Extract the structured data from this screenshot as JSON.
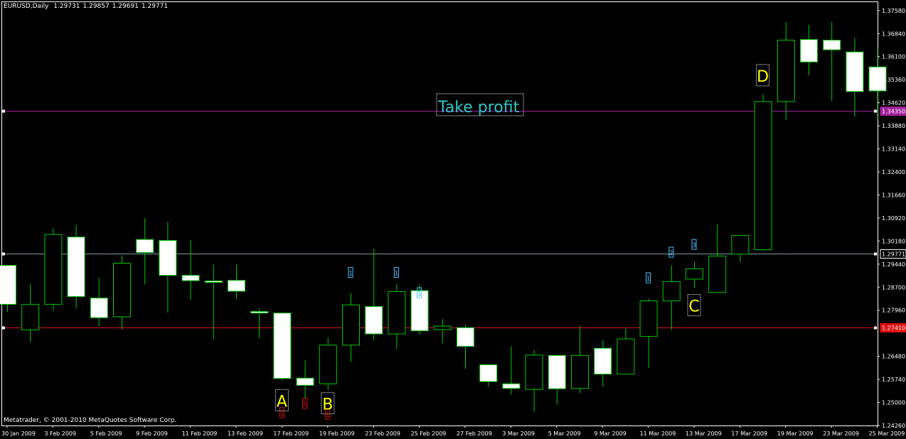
{
  "header": {
    "symbol": "EURUSD,Daily",
    "open": "1.29731",
    "high": "1.29857",
    "low": "1.29691",
    "close": "1.29771"
  },
  "footer": {
    "copyright": "Metatrader, © 2001-2010 MetaQuotes Software Corp."
  },
  "colors": {
    "background": "#000000",
    "candle_outline": "#00c800",
    "bull_body": "#000000",
    "bear_body": "#ffffff",
    "bid_line": "#7a9aa0",
    "take_profit_line": "#a0209a",
    "entry_line": "#e01010",
    "pattern_label": "#ffff00",
    "take_profit_label": "#2ec8c8",
    "wave_marker": "#4ac0ff"
  },
  "chart_data": {
    "type": "candlestick",
    "symbol": "EURUSD",
    "timeframe": "Daily",
    "ylim": [
      1.2426,
      1.3785
    ],
    "y_ticks": [
      "1.37580",
      "1.36840",
      "1.36100",
      "1.35360",
      "1.34620",
      "1.33880",
      "1.33140",
      "1.32400",
      "1.31660",
      "1.30920",
      "1.30180",
      "1.29440",
      "1.28700",
      "1.27960",
      "1.26480",
      "1.25740",
      "1.25000",
      "1.24260"
    ],
    "x_ticks": [
      "30 Jan 2009",
      "3 Feb 2009",
      "5 Feb 2009",
      "9 Feb 2009",
      "11 Feb 2009",
      "13 Feb 2009",
      "17 Feb 2009",
      "19 Feb 2009",
      "23 Feb 2009",
      "25 Feb 2009",
      "27 Feb 2009",
      "3 Mar 2009",
      "5 Mar 2009",
      "9 Mar 2009",
      "11 Mar 2009",
      "13 Mar 2009",
      "17 Mar 2009",
      "19 Mar 2009",
      "23 Mar 2009",
      "25 Mar 2009"
    ],
    "candles": [
      {
        "date": "30 Jan 2009",
        "open": 1.294,
        "high": 1.294,
        "low": 1.279,
        "close": 1.2815
      },
      {
        "date": "2 Feb 2009",
        "open": 1.2733,
        "high": 1.288,
        "low": 1.2694,
        "close": 1.2815
      },
      {
        "date": "3 Feb 2009",
        "open": 1.2815,
        "high": 1.3058,
        "low": 1.2795,
        "close": 1.3039
      },
      {
        "date": "4 Feb 2009",
        "open": 1.3031,
        "high": 1.307,
        "low": 1.2802,
        "close": 1.284
      },
      {
        "date": "5 Feb 2009",
        "open": 1.2835,
        "high": 1.29,
        "low": 1.2745,
        "close": 1.2772
      },
      {
        "date": "6 Feb 2009",
        "open": 1.2775,
        "high": 1.2972,
        "low": 1.2735,
        "close": 1.2947
      },
      {
        "date": "9 Feb 2009",
        "open": 1.3023,
        "high": 1.3092,
        "low": 1.2879,
        "close": 1.2981
      },
      {
        "date": "10 Feb 2009",
        "open": 1.302,
        "high": 1.3079,
        "low": 1.2788,
        "close": 1.2908
      },
      {
        "date": "11 Feb 2009",
        "open": 1.2908,
        "high": 1.302,
        "low": 1.283,
        "close": 1.2891
      },
      {
        "date": "12 Feb 2009",
        "open": 1.289,
        "high": 1.2942,
        "low": 1.2702,
        "close": 1.2888
      },
      {
        "date": "13 Feb 2009",
        "open": 1.2892,
        "high": 1.2942,
        "low": 1.2832,
        "close": 1.2857
      },
      {
        "date": "16 Feb 2009",
        "open": 1.2792,
        "high": 1.2802,
        "low": 1.2706,
        "close": 1.2787
      },
      {
        "date": "17 Feb 2009",
        "open": 1.2787,
        "high": 1.2787,
        "low": 1.257,
        "close": 1.2577
      },
      {
        "date": "18 Feb 2009",
        "open": 1.2578,
        "high": 1.2635,
        "low": 1.2511,
        "close": 1.2555
      },
      {
        "date": "19 Feb 2009",
        "open": 1.256,
        "high": 1.2708,
        "low": 1.254,
        "close": 1.2684
      },
      {
        "date": "20 Feb 2009",
        "open": 1.2684,
        "high": 1.285,
        "low": 1.2631,
        "close": 1.2813
      },
      {
        "date": "23 Feb 2009",
        "open": 1.2808,
        "high": 1.2993,
        "low": 1.27,
        "close": 1.272
      },
      {
        "date": "24 Feb 2009",
        "open": 1.272,
        "high": 1.288,
        "low": 1.2672,
        "close": 1.2856
      },
      {
        "date": "25 Feb 2009",
        "open": 1.2859,
        "high": 1.2879,
        "low": 1.2718,
        "close": 1.273
      },
      {
        "date": "26 Feb 2009",
        "open": 1.2734,
        "high": 1.2768,
        "low": 1.269,
        "close": 1.2745
      },
      {
        "date": "27 Feb 2009",
        "open": 1.274,
        "high": 1.275,
        "low": 1.2608,
        "close": 1.268
      },
      {
        "date": "2 Mar 2009",
        "open": 1.2621,
        "high": 1.2621,
        "low": 1.255,
        "close": 1.2567
      },
      {
        "date": "3 Mar 2009",
        "open": 1.256,
        "high": 1.268,
        "low": 1.2525,
        "close": 1.2545
      },
      {
        "date": "4 Mar 2009",
        "open": 1.2542,
        "high": 1.2668,
        "low": 1.247,
        "close": 1.2652
      },
      {
        "date": "5 Mar 2009",
        "open": 1.2651,
        "high": 1.2651,
        "low": 1.2493,
        "close": 1.2544
      },
      {
        "date": "6 Mar 2009",
        "open": 1.2545,
        "high": 1.2746,
        "low": 1.253,
        "close": 1.2651
      },
      {
        "date": "9 Mar 2009",
        "open": 1.2674,
        "high": 1.27,
        "low": 1.2551,
        "close": 1.2591
      },
      {
        "date": "10 Mar 2009",
        "open": 1.2591,
        "high": 1.2738,
        "low": 1.2591,
        "close": 1.2704
      },
      {
        "date": "11 Mar 2009",
        "open": 1.2712,
        "high": 1.2833,
        "low": 1.2611,
        "close": 1.2826
      },
      {
        "date": "12 Mar 2009",
        "open": 1.2826,
        "high": 1.294,
        "low": 1.2733,
        "close": 1.2888
      },
      {
        "date": "13 Mar 2009",
        "open": 1.2896,
        "high": 1.2952,
        "low": 1.2868,
        "close": 1.2929
      },
      {
        "date": "16 Mar 2009",
        "open": 1.2853,
        "high": 1.307,
        "low": 1.2853,
        "close": 1.297
      },
      {
        "date": "17 Mar 2009",
        "open": 1.2976,
        "high": 1.3033,
        "low": 1.2951,
        "close": 1.3036
      },
      {
        "date": "18 Mar 2009",
        "open": 1.299,
        "high": 1.349,
        "low": 1.2986,
        "close": 1.3466
      },
      {
        "date": "19 Mar 2009",
        "open": 1.3466,
        "high": 1.3721,
        "low": 1.3408,
        "close": 1.3663
      },
      {
        "date": "20 Mar 2009",
        "open": 1.3665,
        "high": 1.3712,
        "low": 1.355,
        "close": 1.3593
      },
      {
        "date": "23 Mar 2009",
        "open": 1.3663,
        "high": 1.3721,
        "low": 1.3468,
        "close": 1.3632
      },
      {
        "date": "24 Mar 2009",
        "open": 1.3625,
        "high": 1.367,
        "low": 1.3418,
        "close": 1.3498
      },
      {
        "date": "25 Mar 2009",
        "open": 1.3577,
        "high": 1.3635,
        "low": 1.3408,
        "close": 1.35
      }
    ],
    "horizontal_lines": [
      {
        "name": "bid",
        "price": 1.29771,
        "label": "1.29771",
        "color": "#7a9aa0"
      },
      {
        "name": "take-profit",
        "price": 1.3435,
        "label": "1.34350",
        "color": "#a0209a"
      },
      {
        "name": "entry",
        "price": 1.2741,
        "label": "1.27410",
        "color": "#e01010"
      }
    ],
    "pattern_labels": [
      {
        "text": "A",
        "date": "17 Feb 2009",
        "price": 1.2505
      },
      {
        "text": "B",
        "date": "19 Feb 2009",
        "price": 1.2495
      },
      {
        "text": "C",
        "date": "13 Mar 2009",
        "price": 1.281
      },
      {
        "text": "D",
        "date": "18 Mar 2009",
        "price": 1.3548
      }
    ],
    "wave_markers": [
      {
        "text": "1",
        "date": "18 Feb 2009",
        "price": 1.2495,
        "color": "#e01010"
      },
      {
        "text": "1",
        "date": "17 Feb 2009",
        "price": 1.2465,
        "color": "#e01010"
      },
      {
        "text": "1",
        "date": "19 Feb 2009",
        "price": 1.246,
        "color": "#e01010"
      },
      {
        "text": "1",
        "date": "20 Feb 2009",
        "price": 1.2915,
        "color": "#4ac0ff"
      },
      {
        "text": "1",
        "date": "24 Feb 2009",
        "price": 1.2915,
        "color": "#4ac0ff"
      },
      {
        "text": "1",
        "date": "25 Feb 2009",
        "price": 1.285,
        "color": "#4ac0ff"
      },
      {
        "text": "1",
        "date": "11 Mar 2009",
        "price": 1.2898,
        "color": "#4ac0ff"
      },
      {
        "text": "2",
        "date": "12 Mar 2009",
        "price": 1.298,
        "color": "#4ac0ff"
      },
      {
        "text": "3",
        "date": "13 Mar 2009",
        "price": 1.3005,
        "color": "#4ac0ff"
      }
    ],
    "annotations": [
      {
        "text": "Take profit",
        "date": "25 Feb 2009",
        "price": 1.3466
      }
    ]
  }
}
